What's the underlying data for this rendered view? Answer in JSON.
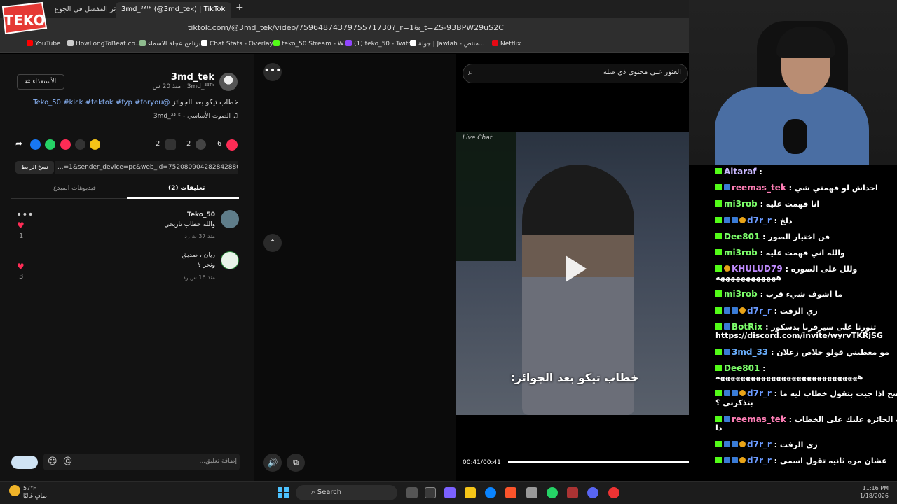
{
  "browser": {
    "tabs": [
      {
        "label": "جائزة المؤثر المفضل في الجوع"
      },
      {
        "label": "3md_³³ᵀᵏ (@3md_tek) | TikTok",
        "close": "×"
      }
    ],
    "new_tab": "+",
    "url": "tiktok.com/@3md_tek/video/7596487437975571730?_r=1&_t=ZS-93BPW29uS2C",
    "bookmarks": [
      {
        "label": "YouTube",
        "color": "#ff0000"
      },
      {
        "label": "HowLongToBeat.co...",
        "color": "#cccccc"
      },
      {
        "label": "برنامج عجلة الاسماء",
        "color": "#8fbc8f"
      },
      {
        "label": "Chat Stats - Overlay...",
        "color": "#ffffff"
      },
      {
        "label": "teko_50 Stream - W...",
        "color": "#53fc18"
      },
      {
        "label": "(1) teko_50 - Twitch",
        "color": "#9146ff"
      },
      {
        "label": "جولة | Jawlah - منتص...",
        "color": "#ffffff"
      },
      {
        "label": "Netflix",
        "color": "#e50914"
      }
    ],
    "logo_text": "TEKO"
  },
  "post": {
    "username": "3md_tek",
    "subline": "3md_³³ᵀᵏ · منذ 20 س",
    "follow_label": "الأستقذاء",
    "caption_text": "خطاب تيكو بعد الجوائز",
    "caption_tags": "@Teko_50 #kick #tektok #fyp #foryou",
    "sound": "الصوت الأساسي - 3md_³³ᵀᵏ",
    "likes": "6",
    "comments": "2",
    "saves": "2",
    "copy_label": "نسخ الرابط",
    "link": "...=1&sender_device=pc&web_id=7520809042828428807",
    "tab_comments": "تعليقات (2)",
    "tab_creator": "فيديوهات المبدع"
  },
  "comments": [
    {
      "name": "Teko_50",
      "text": "والله خطاب تاريخي",
      "meta": "منذ 37 ث   رد",
      "likes": "1"
    },
    {
      "name": "ريان ، صديق",
      "text": "ونحر ؟",
      "meta": "منذ 16 س   رد",
      "likes": "3"
    }
  ],
  "comment_input": {
    "placeholder": "إضافة تعليق...",
    "emoji": "☺",
    "at": "@"
  },
  "player": {
    "more": "•••",
    "up": "⌃",
    "volume": "🔊",
    "pip": "⧉",
    "search_text": "العثور على محتوى ذي صلة",
    "search_icon": "⌕",
    "video_chat_label": "Live Chat",
    "subtitle": "خطاب تيكو بعد الجوائز:",
    "time": "00:41/00:41",
    "progress": 1.0
  },
  "stream_chat": [
    {
      "user": "Altaraf",
      "msg": ":",
      "badges": [],
      "color": "#c9b8ff"
    },
    {
      "user": "reemas_tek",
      "msg": ": احداش لو فهمتي شي",
      "badges": [
        "b"
      ],
      "color": "#ff7eb6"
    },
    {
      "user": "mi3rob",
      "msg": ": انا فهمت عليه",
      "badges": [],
      "color": "#7dff6b"
    },
    {
      "user": "d7r_r",
      "msg": ": دلخ",
      "badges": [
        "b",
        "b",
        "bo"
      ],
      "color": "#6b9bff"
    },
    {
      "user": "Dee801",
      "msg": ": فن اختيار الصور",
      "badges": [],
      "color": "#7dff6b"
    },
    {
      "user": "mi3rob",
      "msg": ": والله اني فهمت عليه",
      "badges": [],
      "color": "#7dff6b"
    },
    {
      "user": "KHULUD79",
      "msg": ": وللل على الصوره",
      "badges": [
        "bo"
      ],
      "color": "#c08bff"
    },
    {
      "user": "",
      "msg": "ههههههههههههه",
      "badges": [],
      "color": "#ffffff"
    },
    {
      "user": "mi3rob",
      "msg": ": ما اشوف شيء قرب",
      "badges": [],
      "color": "#7dff6b"
    },
    {
      "user": "d7r_r",
      "msg": ": زي الزفت",
      "badges": [
        "b",
        "b",
        "bo"
      ],
      "color": "#6b9bff"
    },
    {
      "user": "BotRix",
      "msg": ": تنورنا على سيرفرنا بدسكور",
      "badges": [
        "b"
      ],
      "color": "#7dff6b"
    },
    {
      "user": "",
      "msg": "https://discord.com/invite/wyrvTKRjSG",
      "badges": [],
      "color": "#ffffff"
    },
    {
      "user": "3md_33",
      "msg": ": مو معطيني فولو خلاص زعلان",
      "badges": [
        "b"
      ],
      "color": "#6bb0ff"
    },
    {
      "user": "Dee801",
      "msg": ":",
      "badges": [],
      "color": "#7dff6b"
    },
    {
      "user": "",
      "msg": "ههههههههههههههههههههههههههههه",
      "badges": [],
      "color": "#ffffff"
    },
    {
      "user": "d7r_r",
      "msg": ": صح اذا جيت بتقول خطاب ليه ما",
      "badges": [
        "b",
        "b",
        "bo"
      ],
      "color": "#6b9bff"
    },
    {
      "user": "",
      "msg": "بتذكرني ؟",
      "badges": [],
      "color": "#ffffff"
    },
    {
      "user": "reemas_tek",
      "msg": ": بيحذف الجائزه عليك على الخطاب",
      "badges": [
        "b"
      ],
      "color": "#ff7eb6"
    },
    {
      "user": "",
      "msg": "ذا",
      "badges": [],
      "color": "#ffffff"
    },
    {
      "user": "d7r_r",
      "msg": ": زي الزفت",
      "badges": [
        "b",
        "b",
        "bo"
      ],
      "color": "#6b9bff"
    },
    {
      "user": "d7r_r",
      "msg": ": عشان مره ثانيه تقول اسمي",
      "badges": [
        "b",
        "b",
        "bo"
      ],
      "color": "#6b9bff"
    }
  ],
  "taskbar": {
    "temp": "57°F",
    "weather": "صافٍ غالبًا",
    "search": "Search",
    "time": "11:16 PM",
    "date": "1/18/2026"
  }
}
